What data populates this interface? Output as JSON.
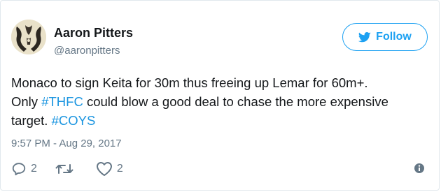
{
  "user": {
    "name": "Aaron Pitters",
    "handle": "@aaronpitters"
  },
  "follow_button": {
    "label": "Follow",
    "icon": "twitter-bird-icon"
  },
  "tweet": {
    "line1": "Monaco to sign Keita for 30m thus freeing up Lemar for 60m+.",
    "line2_before": "Only ",
    "hashtag_thfc": "#THFC",
    "line2_after": " could blow a good deal to chase the more expensive",
    "line3_before": "target. ",
    "hashtag_coys": "#COYS",
    "timestamp": "9:57 PM - Aug 29, 2017"
  },
  "actions": {
    "reply_count": "2",
    "retweet_count": "",
    "like_count": "2",
    "reply_icon": "reply-icon",
    "retweet_icon": "retweet-icon",
    "like_icon": "heart-icon",
    "info_icon": "info-icon"
  },
  "colors": {
    "accent": "#1da1f2",
    "hashtag": "#1b95e0",
    "muted": "#657786",
    "text": "#14171a"
  }
}
